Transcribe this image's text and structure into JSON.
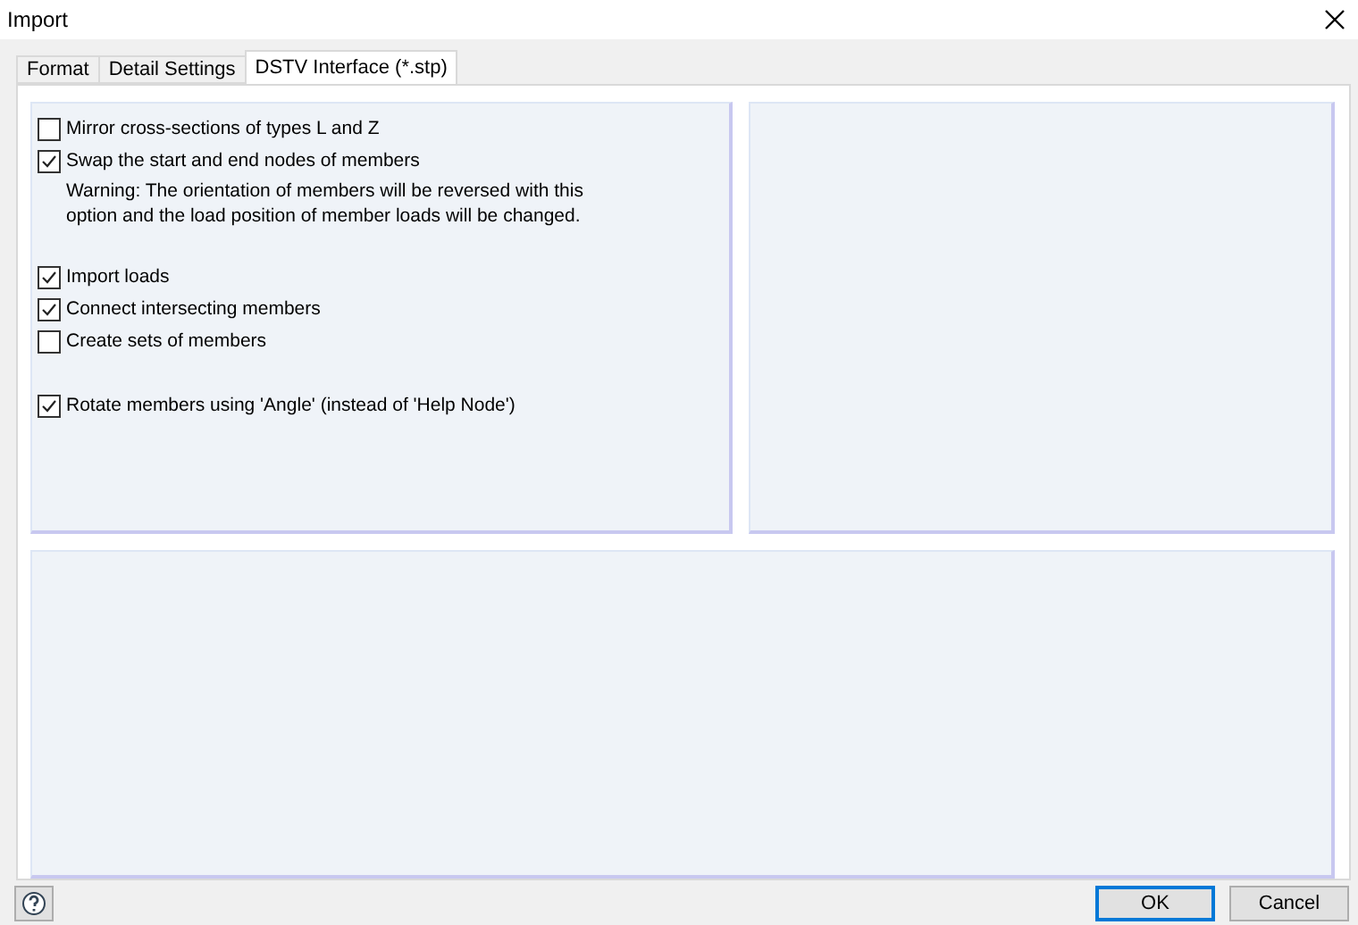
{
  "window": {
    "title": "Import"
  },
  "tabs": [
    {
      "label": "Format",
      "selected": false
    },
    {
      "label": "Detail Settings",
      "selected": false
    },
    {
      "label": "DSTV Interface (*.stp)",
      "selected": true
    }
  ],
  "option_groups": [
    [
      {
        "kind": "checkbox",
        "label": "Mirror cross-sections of types L and Z",
        "checked": false
      },
      {
        "kind": "checkbox",
        "label": "Swap the start and end nodes of members",
        "checked": true
      },
      {
        "kind": "note",
        "label": "Warning: The orientation of members will be reversed with this option and the load position of member loads will be changed."
      }
    ],
    [
      {
        "kind": "checkbox",
        "label": "Import loads",
        "checked": true
      },
      {
        "kind": "checkbox",
        "label": "Connect intersecting members",
        "checked": true
      },
      {
        "kind": "checkbox",
        "label": "Create sets of members",
        "checked": false
      }
    ],
    [
      {
        "kind": "checkbox",
        "label": "Rotate members using 'Angle' (instead of 'Help Node')",
        "checked": true
      }
    ]
  ],
  "buttons": [
    {
      "label": "OK",
      "default": true
    },
    {
      "label": "Cancel",
      "default": false
    }
  ]
}
